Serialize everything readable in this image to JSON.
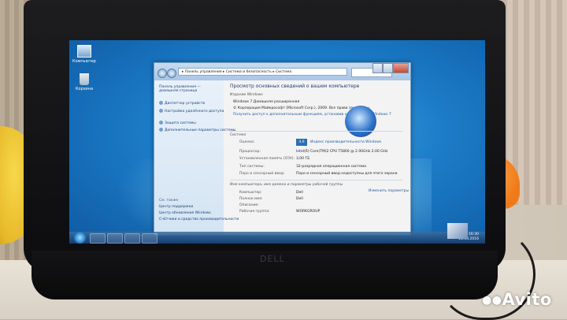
{
  "desktop": {
    "icons": [
      {
        "label": "Компьютер",
        "icon": "computer-icon"
      },
      {
        "label": "Корзина",
        "icon": "recycle-bin-icon"
      }
    ]
  },
  "window": {
    "address": "▸ Панель управления ▸ Система и безопасность ▸ Система",
    "sidebar": {
      "home": "Панель управления — домашняя страница",
      "links": [
        "Диспетчер устройств",
        "Настройка удалённого доступа",
        "Защита системы",
        "Дополнительные параметры системы"
      ],
      "see_also": "См. также",
      "bottom_links": [
        "Центр поддержки",
        "Центр обновления Windows",
        "Счётчики и средства производительности"
      ]
    },
    "main": {
      "heading": "Просмотр основных сведений о вашем компьютере",
      "edition_section": "Издание Windows",
      "edition": "Windows 7 Домашняя расширенная",
      "copyright": "© Корпорация Майкрософт (Microsoft Corp.), 2009. Все права защищены.",
      "upgrade": "Получить доступ к дополнительным функциям, установив новый выпуск Windows 7",
      "system_section": "Система",
      "rating_label": "Оценка:",
      "rating_value": "4,6",
      "rating_link": "Индекс производительности Windows",
      "rows": [
        {
          "label": "Процессор:",
          "value": "Intel(R) Core(TM)2 CPU  T5800 @ 2.00GHz  2.00 GHz"
        },
        {
          "label": "Установленная память (ОЗУ):",
          "value": "3,00 ГБ"
        },
        {
          "label": "Тип системы:",
          "value": "32-разрядная операционная система"
        },
        {
          "label": "Перо и сенсорный ввод:",
          "value": "Перо и сенсорный ввод недоступны для этого экрана"
        }
      ],
      "name_section": "Имя компьютера, имя домена и параметры рабочей группы",
      "change_link": "Изменить параметры",
      "name_rows": [
        {
          "label": "Компьютер:",
          "value": "Dell"
        },
        {
          "label": "Полное имя:",
          "value": "Dell"
        },
        {
          "label": "Описание:",
          "value": ""
        },
        {
          "label": "Рабочая группа:",
          "value": "WORKGROUP"
        }
      ]
    }
  },
  "taskbar": {
    "time": "16:30",
    "date": "16.04.2016"
  },
  "monitor": {
    "brand": "DELL"
  },
  "watermark": {
    "text": "Avito"
  },
  "colors": {
    "screen_blue": "#1c7cc8",
    "window_bg": "#f3f3f3",
    "link": "#1a5aa8"
  }
}
